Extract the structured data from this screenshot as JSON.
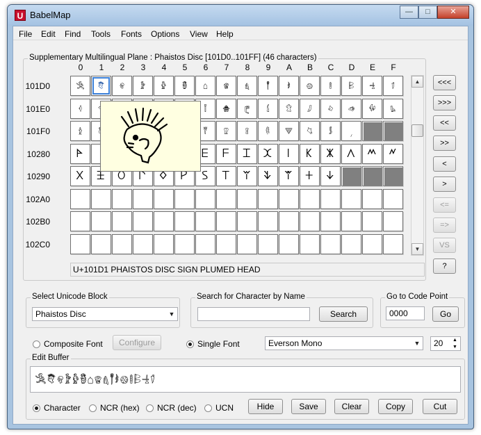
{
  "window": {
    "title": "BabelMap",
    "app_icon": "U"
  },
  "menu": [
    "File",
    "Edit",
    "Find",
    "Tools",
    "Fonts",
    "Options",
    "View",
    "Help"
  ],
  "grid": {
    "label": "Supplementary Multilingual Plane : Phaistos Disc [101D0..101FF] (46 characters)",
    "col_headers": [
      "0",
      "1",
      "2",
      "3",
      "4",
      "5",
      "6",
      "7",
      "8",
      "9",
      "A",
      "B",
      "C",
      "D",
      "E",
      "F"
    ],
    "rows": [
      {
        "label": "101D0",
        "cells": [
          "𐇐",
          "𐇑",
          "𐇒",
          "𐇓",
          "𐇔",
          "𐇕",
          "𐇖",
          "𐇗",
          "𐇘",
          "𐇙",
          "𐇚",
          "𐇛",
          "𐇜",
          "𐇝",
          "𐇞",
          "𐇟"
        ]
      },
      {
        "label": "101E0",
        "cells": [
          "𐇠",
          "𐇡",
          "",
          "",
          "",
          "𐇥",
          "𐇦",
          "𐇧",
          "𐇨",
          "𐇩",
          "𐇪",
          "𐇫",
          "𐇬",
          "𐇭",
          "𐇮",
          "𐇯"
        ]
      },
      {
        "label": "101F0",
        "cells": [
          "𐇰",
          "𐇱",
          "",
          "",
          "",
          "𐇵",
          "𐇶",
          "𐇷",
          "𐇸",
          "𐇹",
          "𐇺",
          "𐇻",
          "𐇼",
          "𐇽",
          "",
          ""
        ]
      },
      {
        "label": "10280",
        "cells": [
          "𐊀",
          "",
          "",
          "",
          "",
          "𐊅",
          "𐊆",
          "𐊇",
          "𐊈",
          "𐊉",
          "𐊊",
          "𐊋",
          "𐊌",
          "𐊍",
          "𐊎",
          "𐊏"
        ]
      },
      {
        "label": "10290",
        "cells": [
          "𐊐",
          "𐊑",
          "𐊒",
          "𐊓",
          "𐊔",
          "𐊕",
          "𐊖",
          "𐊗",
          "𐊘",
          "𐊙",
          "𐊚",
          "𐊛",
          "𐊜",
          "",
          "",
          ""
        ]
      },
      {
        "label": "102A0",
        "cells": [
          "",
          "",
          "",
          "",
          "",
          "",
          "",
          "",
          "",
          "",
          "",
          "",
          "",
          "",
          "",
          ""
        ]
      },
      {
        "label": "102B0",
        "cells": [
          "",
          "",
          "",
          "",
          "",
          "",
          "",
          "",
          "",
          "",
          "",
          "",
          "",
          "",
          "",
          ""
        ]
      },
      {
        "label": "102C0",
        "cells": [
          "",
          "",
          "",
          "",
          "",
          "",
          "",
          "",
          "",
          "",
          "",
          "",
          "",
          "",
          "",
          ""
        ]
      }
    ],
    "gray_cells": [
      [
        2,
        14
      ],
      [
        2,
        15
      ],
      [
        4,
        13
      ],
      [
        4,
        14
      ],
      [
        4,
        15
      ]
    ],
    "selected_cell": [
      0,
      1
    ],
    "status_text": "U+101D1 PHAISTOS DISC SIGN PLUMED HEAD"
  },
  "nav_buttons": [
    {
      "label": "<<<",
      "enabled": true
    },
    {
      "label": ">>>",
      "enabled": true
    },
    {
      "label": "<<",
      "enabled": true
    },
    {
      "label": ">>",
      "enabled": true
    },
    {
      "label": "<",
      "enabled": true
    },
    {
      "label": ">",
      "enabled": true
    },
    {
      "label": "<=",
      "enabled": false
    },
    {
      "label": "=>",
      "enabled": false
    },
    {
      "label": "VS",
      "enabled": false
    },
    {
      "label": "?",
      "enabled": true
    }
  ],
  "select_block": {
    "label": "Select Unicode Block",
    "value": "Phaistos Disc"
  },
  "search": {
    "label": "Search for Character by Name",
    "value": "",
    "button": "Search"
  },
  "goto": {
    "label": "Go to Code Point",
    "value": "0000",
    "button": "Go"
  },
  "font_options": {
    "composite_label": "Composite Font",
    "configure_label": "Configure",
    "single_label": "Single Font",
    "font_name": "Everson Mono",
    "font_size": "20"
  },
  "edit_buffer": {
    "label": "Edit Buffer",
    "content": "𐇐𐇑𐇒𐇓𐇔𐇕𐇖𐇗𐇘𐇙𐇚𐇛𐇜𐇝𐇞𐇟"
  },
  "bottom": {
    "radios": [
      "Character",
      "NCR (hex)",
      "NCR (dec)",
      "UCN"
    ],
    "buttons": [
      "Hide",
      "Save",
      "Clear",
      "Copy",
      "Cut"
    ]
  }
}
